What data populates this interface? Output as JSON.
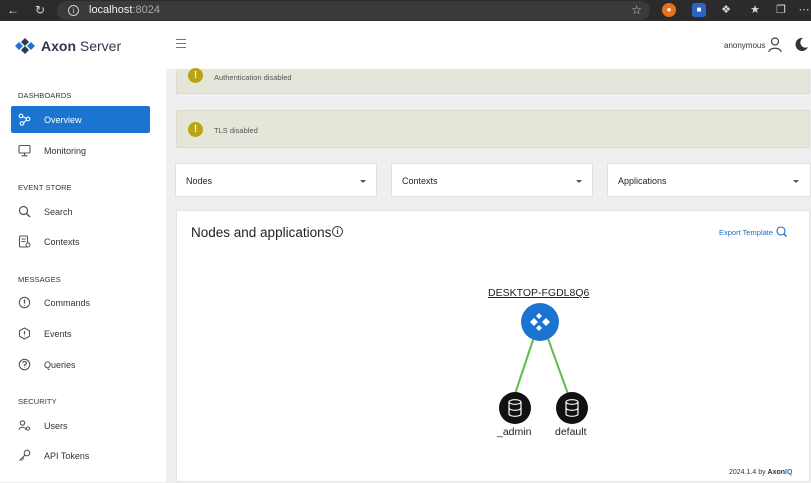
{
  "browser": {
    "url_host": "localhost",
    "url_port": ":8024"
  },
  "header": {
    "logo_word1": "Axon",
    "logo_word2": " Server",
    "user": "anonymous"
  },
  "sidebar": {
    "sections": [
      {
        "title": "DASHBOARDS",
        "items": [
          "Overview",
          "Monitoring"
        ]
      },
      {
        "title": "EVENT STORE",
        "items": [
          "Search",
          "Contexts"
        ]
      },
      {
        "title": "MESSAGES",
        "items": [
          "Commands",
          "Events",
          "Queries"
        ]
      },
      {
        "title": "SECURITY",
        "items": [
          "Users",
          "API Tokens"
        ]
      }
    ],
    "active": "Overview"
  },
  "alerts": [
    {
      "text": "Authentication disabled",
      "icon": "warning-icon"
    },
    {
      "text": "TLS disabled",
      "icon": "warning-icon"
    }
  ],
  "filters": {
    "nodes": "Nodes",
    "contexts": "Contexts",
    "applications": "Applications"
  },
  "card": {
    "title": "Nodes and applications",
    "export_label": "Export Template",
    "host_node": "DESKTOP-FGDL8Q6",
    "contexts": [
      "_admin",
      "default"
    ],
    "footer_version": "2024.1.4 by ",
    "footer_brand_a": "Axon",
    "footer_brand_b": "IQ"
  },
  "colors": {
    "accent": "#1b75d0",
    "alert_bg": "#e6e5da",
    "alert_icon": "#b9a316",
    "link_green": "#5bbf4a"
  }
}
